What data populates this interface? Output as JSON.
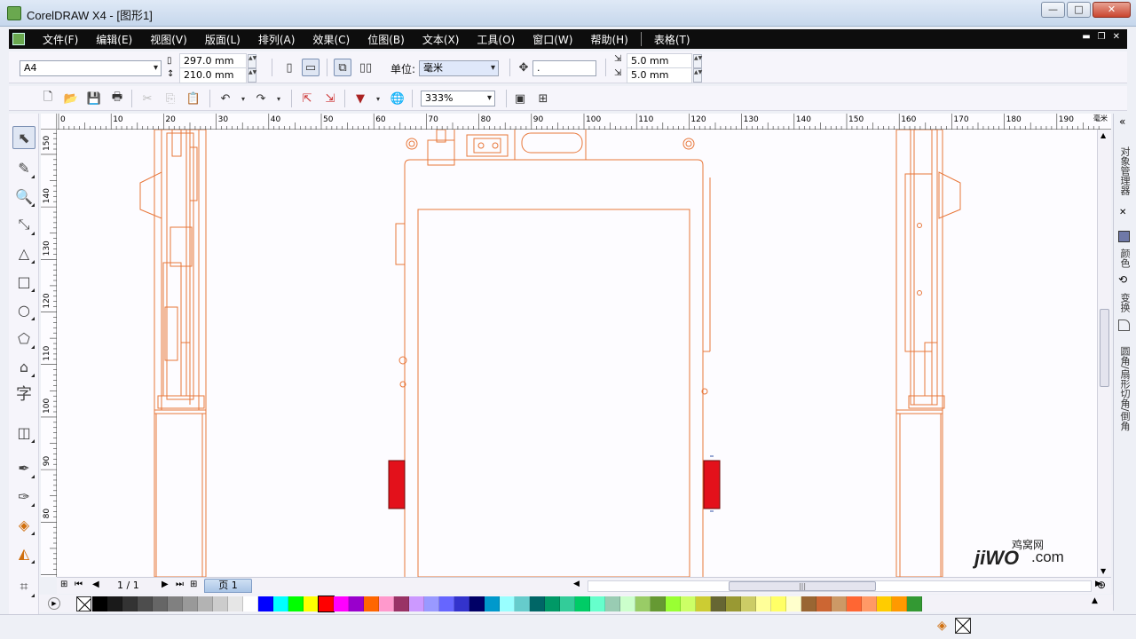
{
  "window": {
    "title": "CorelDRAW X4 - [图形1]",
    "min": "—",
    "max": "□",
    "close": "✕"
  },
  "menu": [
    "文件(F)",
    "编辑(E)",
    "视图(V)",
    "版面(L)",
    "排列(A)",
    "效果(C)",
    "位图(B)",
    "文本(X)",
    "工具(O)",
    "窗口(W)",
    "帮助(H)",
    "表格(T)"
  ],
  "property_bar": {
    "page_size": "A4",
    "width": "297.0 mm",
    "height": "210.0 mm",
    "units_label": "单位:",
    "units_value": "毫米",
    "nudge_value": ".",
    "dup_x": "5.0 mm",
    "dup_y": "5.0 mm"
  },
  "standard_bar": {
    "zoom": "333%"
  },
  "rulers": {
    "horizontal_ticks": [
      "0",
      "10",
      "20",
      "30",
      "40",
      "50",
      "60",
      "70",
      "80",
      "90",
      "100",
      "110",
      "120",
      "130",
      "140",
      "150",
      "160",
      "170",
      "180",
      "190"
    ],
    "horizontal_unit": "毫米",
    "vertical_ticks": [
      "150",
      "140",
      "130",
      "120",
      "110",
      "100",
      "90",
      "80"
    ]
  },
  "page_nav": {
    "counter": "1 / 1",
    "tab": "页 1"
  },
  "dockers": {
    "tab1": "对象管理器",
    "tab2": "颜色",
    "tab3": "变换",
    "tab4": "圆角/扇形切角/倒角"
  },
  "watermark": {
    "brand": "jiwo.com",
    "cn": "鸡窝网",
    "latin": "jiWO",
    "dotcom": ".com"
  },
  "palette": [
    "#000000",
    "#1a1a1a",
    "#333333",
    "#4d4d4d",
    "#666666",
    "#808080",
    "#999999",
    "#b3b3b3",
    "#cccccc",
    "#e6e6e6",
    "#ffffff",
    "#0000ff",
    "#00ffff",
    "#00ff00",
    "#ffff00",
    "#ff0000",
    "#ff00ff",
    "#9900cc",
    "#ff6600",
    "#ff99cc",
    "#993366",
    "#cc99ff",
    "#9999ff",
    "#6666ff",
    "#3333cc",
    "#000066",
    "#0099cc",
    "#99ffff",
    "#66cccc",
    "#006666",
    "#009966",
    "#33cc99",
    "#00cc66",
    "#66ffcc",
    "#99ccb3",
    "#ccffcc",
    "#99cc66",
    "#669933",
    "#99ff33",
    "#ccff66",
    "#cccc33",
    "#666633",
    "#999933",
    "#cccc66",
    "#ffff99",
    "#ffff66",
    "#ffffcc",
    "#996633",
    "#cc6633",
    "#cc9966",
    "#ff6633",
    "#ff9966",
    "#ffcc00",
    "#ff9900",
    "#339933"
  ],
  "colors": {
    "drawing_stroke": "#e8773a",
    "accent_fill": "#e3111b",
    "page_bg": "#fdfcff"
  }
}
